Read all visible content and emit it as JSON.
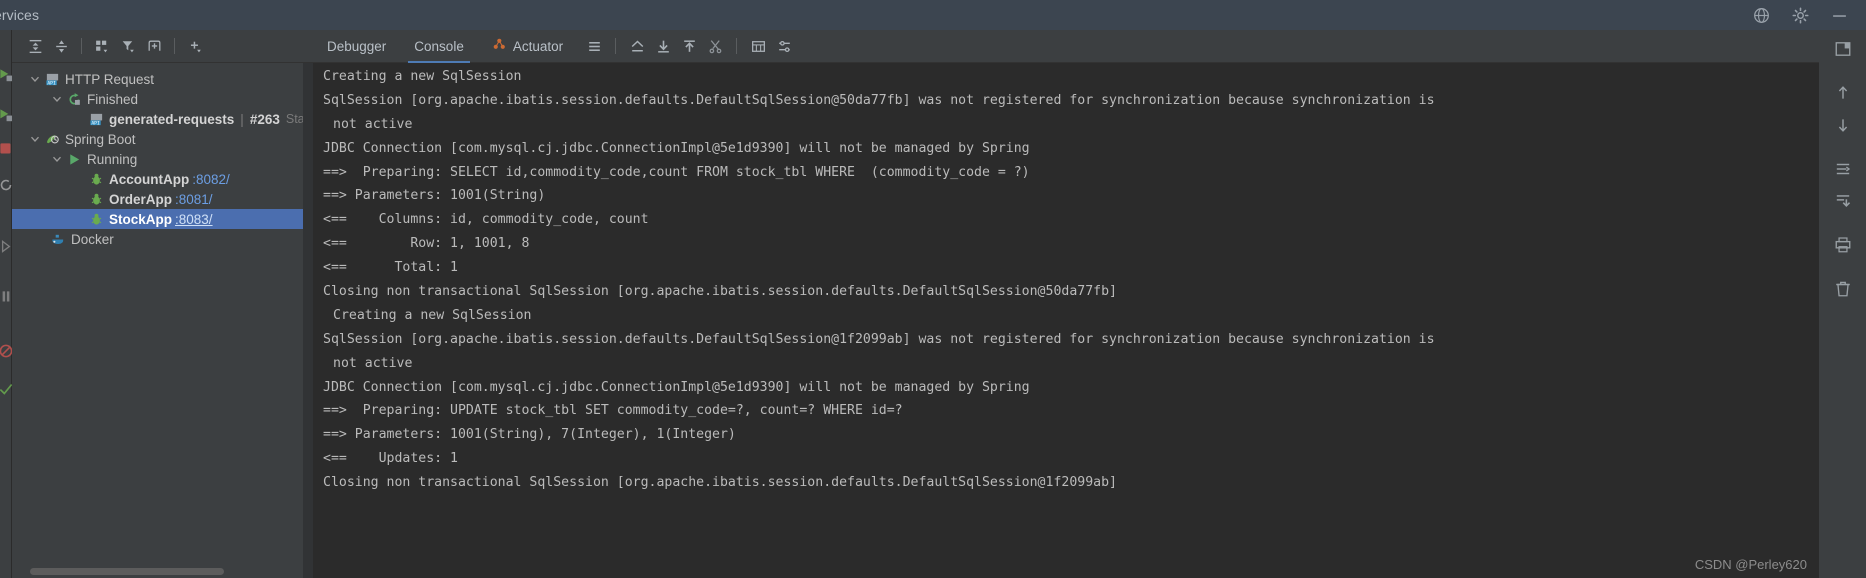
{
  "window": {
    "title": "ervices",
    "title_icons": [
      "globe-icon",
      "settings-gear-icon",
      "minimize-icon"
    ]
  },
  "services_toolbar": {
    "buttons": [
      {
        "name": "expand-all-button",
        "icon": "expand-all-icon"
      },
      {
        "name": "collapse-all-button",
        "icon": "collapse-all-icon"
      },
      {
        "name": "group-by-button",
        "icon": "group-by-icon"
      },
      {
        "name": "filter-button",
        "icon": "filter-icon"
      },
      {
        "name": "add-tab-button",
        "icon": "add-frame-icon"
      },
      {
        "name": "add-service-button",
        "icon": "plus-icon"
      }
    ]
  },
  "tree": {
    "nodes": [
      {
        "id": "http-request",
        "label": "HTTP Request",
        "icon": "api-request-icon",
        "indent": 0,
        "expanded": true,
        "bold": false,
        "selected": false
      },
      {
        "id": "finished",
        "label": "Finished",
        "icon": "rerun-green-icon",
        "indent": 1,
        "expanded": true,
        "bold": false,
        "selected": false
      },
      {
        "id": "generated-requests",
        "label": "generated-requests",
        "icon": "api-request-icon",
        "indent": 2,
        "bold": true,
        "selected": false,
        "suffix_sep": "|",
        "suffix_num": "#263",
        "suffix_dim": "Statu"
      },
      {
        "id": "spring-boot",
        "label": "Spring Boot",
        "icon": "spring-leaf-icon",
        "indent": 0,
        "expanded": true,
        "bold": false,
        "selected": false
      },
      {
        "id": "running",
        "label": "Running",
        "icon": "run-play-icon",
        "indent": 1,
        "expanded": true,
        "bold": false,
        "selected": false
      },
      {
        "id": "account-app",
        "label": "AccountApp",
        "icon": "debug-bug-icon",
        "indent": 2,
        "bold": true,
        "selected": false,
        "port": ":8082/"
      },
      {
        "id": "order-app",
        "label": "OrderApp",
        "icon": "debug-bug-icon",
        "indent": 2,
        "bold": true,
        "selected": false,
        "port": ":8081/"
      },
      {
        "id": "stock-app",
        "label": "StockApp",
        "icon": "debug-bug-icon",
        "indent": 2,
        "bold": true,
        "selected": true,
        "port": ":8083/"
      },
      {
        "id": "docker",
        "label": "Docker",
        "icon": "docker-whale-icon",
        "indent": 0,
        "expanded": false,
        "bold": false,
        "selected": false
      }
    ]
  },
  "tabs": {
    "items": [
      {
        "id": "debugger",
        "label": "Debugger",
        "active": false,
        "icon": null
      },
      {
        "id": "console",
        "label": "Console",
        "active": true,
        "icon": null
      },
      {
        "id": "actuator",
        "label": "Actuator",
        "active": false,
        "icon": "actuator-beans-icon"
      }
    ],
    "toolbar_buttons": [
      {
        "name": "soft-wrap-button",
        "icon": "lines-icon"
      },
      {
        "name": "scroll-to-top-button",
        "icon": "up-chevron-line-icon"
      },
      {
        "name": "scroll-to-end-button",
        "icon": "arrow-down-line-icon"
      },
      {
        "name": "scroll-to-start-button",
        "icon": "arrow-up-line-icon"
      },
      {
        "name": "clear-filter-button",
        "icon": "cut-icon"
      },
      {
        "name": "print-layout-button",
        "icon": "table-icon"
      },
      {
        "name": "settings-lines-button",
        "icon": "sliders-icon"
      }
    ]
  },
  "console": {
    "lines": [
      {
        "text": "Creating a new SqlSession",
        "indent": false
      },
      {
        "text": "SqlSession [org.apache.ibatis.session.defaults.DefaultSqlSession@50da77fb] was not registered for synchronization because synchronization is",
        "indent": false
      },
      {
        "text": "not active",
        "indent": true
      },
      {
        "text": "JDBC Connection [com.mysql.cj.jdbc.ConnectionImpl@5e1d9390] will not be managed by Spring",
        "indent": false
      },
      {
        "text": "==>  Preparing: SELECT id,commodity_code,count FROM stock_tbl WHERE  (commodity_code = ?)",
        "indent": false
      },
      {
        "text": "==> Parameters: 1001(String)",
        "indent": false
      },
      {
        "text": "<==    Columns: id, commodity_code, count",
        "indent": false
      },
      {
        "text": "<==        Row: 1, 1001, 8",
        "indent": false
      },
      {
        "text": "<==      Total: 1",
        "indent": false
      },
      {
        "text": "Closing non transactional SqlSession [org.apache.ibatis.session.defaults.DefaultSqlSession@50da77fb]",
        "indent": false
      },
      {
        "text": "Creating a new SqlSession",
        "indent": true
      },
      {
        "text": "SqlSession [org.apache.ibatis.session.defaults.DefaultSqlSession@1f2099ab] was not registered for synchronization because synchronization is",
        "indent": false
      },
      {
        "text": "not active",
        "indent": true
      },
      {
        "text": "JDBC Connection [com.mysql.cj.jdbc.ConnectionImpl@5e1d9390] will not be managed by Spring",
        "indent": false
      },
      {
        "text": "==>  Preparing: UPDATE stock_tbl SET commodity_code=?, count=? WHERE id=?",
        "indent": false
      },
      {
        "text": "==> Parameters: 1001(String), 7(Integer), 1(Integer)",
        "indent": false
      },
      {
        "text": "<==    Updates: 1",
        "indent": false
      },
      {
        "text": "Closing non transactional SqlSession [org.apache.ibatis.session.defaults.DefaultSqlSession@1f2099ab]",
        "indent": false
      }
    ]
  },
  "right_rail": {
    "buttons": [
      {
        "name": "layout-panels-button",
        "icon": "layout-panels-icon"
      },
      {
        "name": "step-up-button",
        "icon": "arrow-up-thin-icon"
      },
      {
        "name": "step-down-button",
        "icon": "arrow-down-thin-icon"
      },
      {
        "name": "wrap-text-button",
        "icon": "wrap-text-icon"
      },
      {
        "name": "scroll-end-button",
        "icon": "scroll-to-end-icon"
      },
      {
        "name": "print-button",
        "icon": "printer-icon"
      },
      {
        "name": "delete-button",
        "icon": "trash-icon"
      }
    ]
  },
  "watermark": {
    "text": "CSDN @Perley620"
  },
  "colors": {
    "titlebar_bg": "#3c4550",
    "panel_bg": "#3c3f41",
    "console_bg": "#2b2b2b",
    "selection_blue": "#4b6eaf",
    "link_blue": "#6c9ee3",
    "accent_green": "#6aab4f",
    "actuator_orange": "#cc6a33",
    "text": "#bbbbbb"
  }
}
